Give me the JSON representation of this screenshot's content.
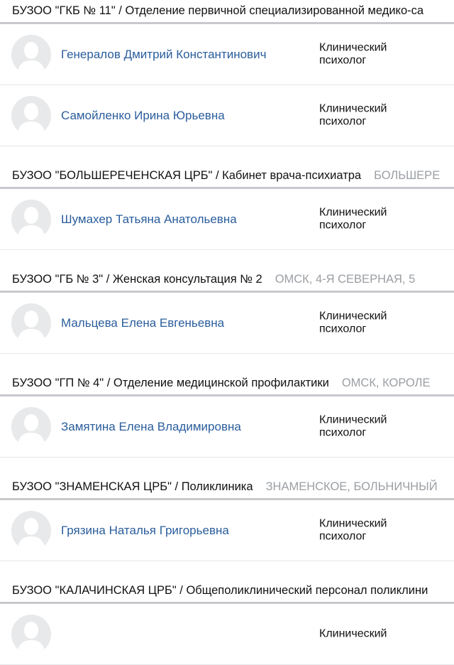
{
  "groups": [
    {
      "name": "БУЗОО \"ГКБ № 11\" / Отделение первичной специализированной медико-са",
      "address": "",
      "people": [
        {
          "name": "Генералов Дмитрий Константинович",
          "role_line1": "Клинический",
          "role_line2": "психолог"
        },
        {
          "name": "Самойленко Ирина Юрьевна",
          "role_line1": "Клинический",
          "role_line2": "психолог"
        }
      ]
    },
    {
      "name": "БУЗОО \"БОЛЬШЕРЕЧЕНСКАЯ ЦРБ\" / Кабинет врача-психиатра",
      "address": "БОЛЬШЕРЕ",
      "people": [
        {
          "name": "Шумахер Татьяна Анатольевна",
          "role_line1": "Клинический",
          "role_line2": "психолог"
        }
      ]
    },
    {
      "name": "БУЗОО \"ГБ № 3\" / Женская консультация № 2",
      "address": "ОМСК, 4-Я СЕВЕРНАЯ, 5",
      "people": [
        {
          "name": "Мальцева Елена Евгеньевна",
          "role_line1": "Клинический",
          "role_line2": "психолог"
        }
      ]
    },
    {
      "name": "БУЗОО \"ГП № 4\" / Отделение медицинской профилактики",
      "address": "ОМСК, КОРОЛЕ",
      "people": [
        {
          "name": "Замятина Елена Владимировна",
          "role_line1": "Клинический",
          "role_line2": "психолог"
        }
      ]
    },
    {
      "name": "БУЗОО \"ЗНАМЕНСКАЯ ЦРБ\" / Поликлиника",
      "address": "ЗНАМЕНСКОЕ, БОЛЬНИЧНЫЙ",
      "people": [
        {
          "name": "Грязина Наталья Григорьевна",
          "role_line1": "Клинический",
          "role_line2": "психолог"
        }
      ]
    },
    {
      "name": "БУЗОО \"КАЛАЧИНСКАЯ ЦРБ\" / Общеполиклинический персонал поликлини",
      "address": "",
      "people": [
        {
          "name": "",
          "role_line1": "Клинический",
          "role_line2": ""
        }
      ]
    }
  ]
}
